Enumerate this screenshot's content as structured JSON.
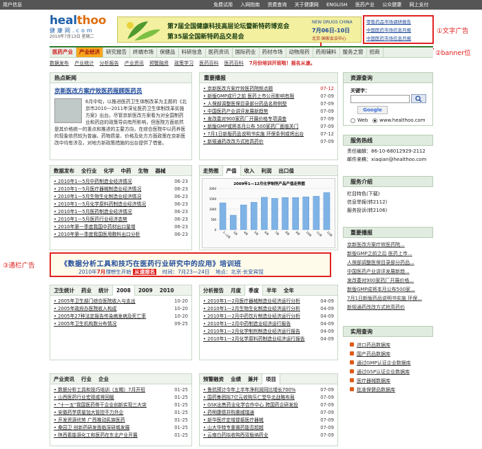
{
  "topbar": {
    "user_info": "用户信息",
    "links": [
      "免费试用",
      "入网指南",
      "资费查询",
      "关于健康网",
      "ENGLISH",
      "医药产业",
      "公众健康",
      "网上支付"
    ]
  },
  "logo": {
    "brand_a": "heal",
    "brand_b": "thoo",
    "brand_c": ".com",
    "cn": "健康网.com",
    "date": "2010年7月13日 星期二"
  },
  "banner": {
    "line1": "第7届全国健康科技高层论坛暨新特药博览会",
    "line2": "第35届全国新特药品交易会",
    "date_line1": "NEW DRUGS CHINA",
    "date_line2": "7月06日-10日",
    "date_line3": "北京·国家会议中心"
  },
  "text_ads": [
    "零售药品市场调研报告",
    "中国医药市场信息月报",
    "中国医药市场信息月报"
  ],
  "annotations": {
    "text_ad": "①文字广告",
    "banner": "②banner位",
    "strip": "③通栏广告"
  },
  "nav": {
    "items": [
      "医药产业",
      "产业经济",
      "研究报告",
      "终端市场",
      "保健品",
      "科研信息",
      "医药资讯",
      "国际药业",
      "药材市场",
      "动物用药",
      "药用辅料",
      "服务之窗",
      "招商"
    ]
  },
  "subnav": {
    "items": [
      "数据发布",
      "产业统计",
      "分析报告",
      "产业资讯",
      "预警融资",
      "政策学习",
      "医药百科",
      "医药百科"
    ],
    "promo": "7月份培训开班啦！报名从速。"
  },
  "hotnews": {
    "header": "热点新闻",
    "title": "京新医改方案疗效医药报顾医药员",
    "body": "6月中旬，以推进医药卫生体制改革为主题的《北京市2010—2011年深化医药卫生体制改革实施方案》出台。尽管京新医改方案看为对全国制药业和药店的政策导向有所影响，但医院方面依然是其价格统一的重点和推进的主要方向，在综合医院中以药养医的现象依然较为普遍，药物质量、价格及处方方面政策在京新医改中均有涉及，对地方新政策措施的出台提供了借鉴。"
  },
  "important": {
    "header": "重要播报",
    "items": [
      {
        "t": "京新医改方案疗效医药院频点题",
        "d": "07-12",
        "red": true
      },
      {
        "t": "新版GMP成行之前 医药上市公司影响有限",
        "d": "07-09"
      },
      {
        "t": "人保部调整医保目录部分药品名称例型",
        "d": "07-09"
      },
      {
        "t": "中国医药产业讲评发展新趋势",
        "d": "07-09"
      },
      {
        "t": "发改委对900家药厂开展价格专项调查",
        "d": "07-09"
      },
      {
        "t": "新版GMP或将本月公布 500家药厂面临关门",
        "d": "07-09"
      },
      {
        "t": "7月1日新版药品说明书实施 环保条例或将出台",
        "d": "07-12"
      },
      {
        "t": "新规通药改改方式抢高药价",
        "d": "07-09"
      }
    ]
  },
  "resource": {
    "header": "资源查询",
    "keyword_label": "关键字：",
    "keyword_value": "",
    "web_label": "Web",
    "site_label": "www.healthoo.com"
  },
  "hotline": {
    "header": "服务热线",
    "editor": "责任编辑：86-10-68012929-2112",
    "email": "邮件来稿：xiaqian@healthoo.com"
  },
  "intro": {
    "header": "服务介绍",
    "lines": [
      "栏目特色(下载)",
      "信息举报(转2112)",
      "服务投诉(转2106)"
    ]
  },
  "important2": {
    "header": "重要播报",
    "items": [
      "京新医改方案疗效医药院...",
      "新版GMP之前之后  医药上市...",
      "人保部调整医保目录部分药品...",
      "中国医药产业讲评发展新趋...",
      "发改委对900家药厂开展价格...",
      "新版GMP成将本月公布500家...",
      "7月1日新版药品说明书实施 环保...",
      "新规通药改改方式抢高药价"
    ]
  },
  "practical": {
    "header": "实用查询",
    "items": [
      "进口药品数据库",
      "国产药品数据库",
      "通过GMP认证企业数据库",
      "通过GSP认证企业数据库",
      "医疗器械数据库",
      "批准保健品数据库"
    ]
  },
  "datarel": {
    "tabs": [
      "数据发布",
      "全行业",
      "化学",
      "中药",
      "生物",
      "器械"
    ],
    "items": [
      {
        "t": "2010年1—5月中药制造业经济情况",
        "d": "06-23"
      },
      {
        "t": "2010年1—5月医疗器械制造业经济情况",
        "d": "06-23"
      },
      {
        "t": "2010年1—5月生物生化制造业经济情况",
        "d": "06-23"
      },
      {
        "t": "2010年1—5月化学原料药制造业经济情况",
        "d": "06-23"
      },
      {
        "t": "2010年1—5月医药制造业经济情况",
        "d": "06-23"
      },
      {
        "t": "2010年1—5月医药行业经济态势",
        "d": "06-23"
      },
      {
        "t": "2010年第一季度我国中药材出口量增",
        "d": "06-23"
      },
      {
        "t": "2010年第一季度我国医用敷料出口分析",
        "d": "06-23"
      }
    ]
  },
  "trend": {
    "tabs": [
      "走势图",
      "产值",
      "收入",
      "利润",
      "出口值"
    ]
  },
  "chart_data": {
    "type": "bar",
    "title": "2009年1—12月化学制剂产品产值走势图",
    "categories": [
      "1—2月",
      "3月",
      "4月",
      "5月",
      "6月",
      "7月",
      "8月",
      "9月",
      "10月",
      "11月",
      "12月"
    ],
    "values": [
      1300,
      700,
      1200,
      1330,
      1570,
      1520,
      1560,
      1560,
      1590,
      1620,
      1800
    ],
    "ylim": [
      0,
      2000
    ],
    "ylabel": "",
    "xlabel": ""
  },
  "strip_ad": {
    "line1": "《数据分析工具和技巧在医药行业研究中的应用》培训班",
    "line2_a": "2010年",
    "line2_b": "7月",
    "line2_c": "理想生开始",
    "line2_d": "从速报名",
    "line2_e": "时间：7月23—24日",
    "line2_f": "地点：北京·长安宾馆"
  },
  "stats": {
    "tabs": [
      "卫生统计",
      "药业",
      "统计",
      "2008",
      "2009",
      "2010"
    ],
    "items": [
      {
        "t": "2005年卫生部门综合医院收入与支出",
        "d": "10-20"
      },
      {
        "t": "2005年政府办医院收入构成",
        "d": "10-20"
      },
      {
        "t": "2005年27种法定报告传染病发病及死亡率",
        "d": "10-20"
      },
      {
        "t": "2005年卫生机构数分布情况",
        "d": "09-25"
      }
    ]
  },
  "analysis": {
    "tabs": [
      "分析报告",
      "月度",
      "季度",
      "半年",
      "全年"
    ],
    "items": [
      {
        "t": "2010年1—2月医疗器械制造业经济运行分析",
        "d": "04-09"
      },
      {
        "t": "2010年1—2月生物生化制造业经济运行分析",
        "d": "04-09"
      },
      {
        "t": "2010年1—2月中药饮片制造业经济运行分析",
        "d": "04-09"
      },
      {
        "t": "2010年1—2月中药制造业经济运行报告",
        "d": "04-09"
      },
      {
        "t": "2010年1—2月化学制剂制造业经济运行报告",
        "d": "04-09"
      },
      {
        "t": "2010年1—2月化学原料药制造业经济运行报告",
        "d": "04-09"
      }
    ]
  },
  "industry": {
    "tabs": [
      "产业资讯",
      "行业",
      "企业"
    ],
    "items": [
      {
        "t": "数据分析工具和技巧培训（五期）7月开班",
        "d": "01-25"
      },
      {
        "t": "山西医药行业宏观或将回暖",
        "d": "01-25"
      },
      {
        "t": "\"十一五\"我国医药骨干企业创新实现三大突",
        "d": "01-25"
      },
      {
        "t": "安徽药学质量加大管控不力外企",
        "d": "01-25"
      },
      {
        "t": "开发资源优势 广西推动民族医药",
        "d": "01-25"
      },
      {
        "t": "桑园卫 创新药研发面临深研城发展",
        "d": "01-25"
      },
      {
        "t": "陕西着能源化工和医药在东北产业开展",
        "d": "01-25"
      }
    ]
  },
  "invest": {
    "tabs": [
      "预警融资",
      "业绩",
      "兼并",
      "项目"
    ],
    "items": [
      {
        "t": "鲁抗预计今年上半年净利润同比增长700%",
        "d": "07-09"
      },
      {
        "t": "国药集团拟7亿元收购乐仁堂华北战略布局",
        "d": "07-09"
      },
      {
        "t": "GSK出售药业化学合作中心 跨国药企研发投",
        "d": "07-09"
      },
      {
        "t": "药明康德并购惠威瑞通",
        "d": "07-09"
      },
      {
        "t": "新华医疗定增提振医疗器械",
        "d": "07-09"
      },
      {
        "t": "山大华特专重微药能否超越",
        "d": "07-09"
      },
      {
        "t": "云南白药拟收购西双版纳药业",
        "d": "07-09"
      }
    ]
  },
  "colors": {
    "accent_red": "#e02020",
    "nav_green": "#2f7a2f",
    "active_orange": "#f7a61c",
    "link_blue": "#1e4a9a",
    "bar_blue": "#7fb3e6"
  }
}
